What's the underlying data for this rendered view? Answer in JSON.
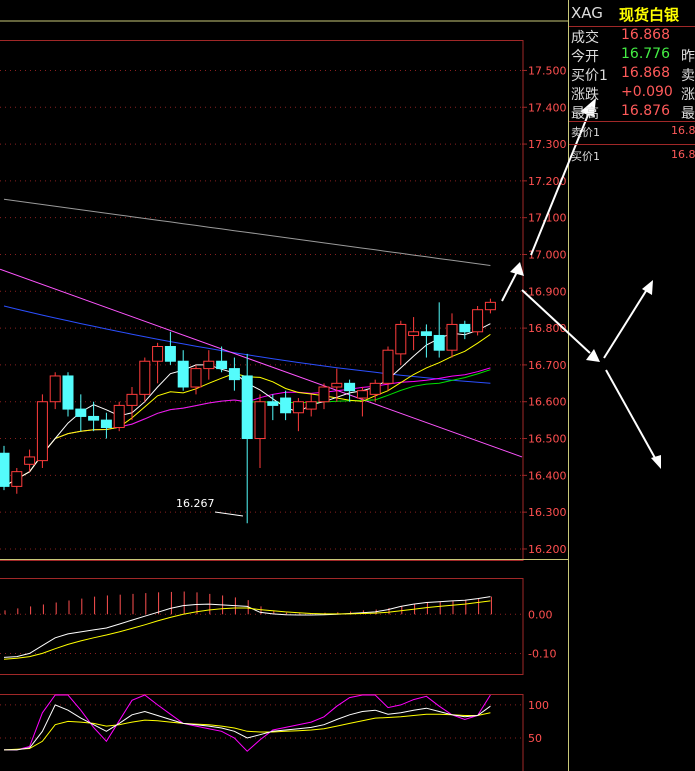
{
  "chart_data": [
    {
      "type": "candlestick",
      "title": "",
      "y_ticks": [
        "17.500",
        "17.400",
        "17.300",
        "17.200",
        "17.100",
        "17.000",
        "16.900",
        "16.800",
        "16.700",
        "16.600",
        "16.500",
        "16.400",
        "16.300",
        "16.200"
      ],
      "ylim": [
        16.17,
        17.58
      ],
      "low_annotation": "16.267",
      "candles": [
        {
          "o": 16.46,
          "h": 16.48,
          "l": 16.36,
          "c": 16.37
        },
        {
          "o": 16.37,
          "h": 16.42,
          "l": 16.35,
          "c": 16.41
        },
        {
          "o": 16.43,
          "h": 16.47,
          "l": 16.41,
          "c": 16.45
        },
        {
          "o": 16.44,
          "h": 16.62,
          "l": 16.42,
          "c": 16.6
        },
        {
          "o": 16.6,
          "h": 16.68,
          "l": 16.58,
          "c": 16.67
        },
        {
          "o": 16.67,
          "h": 16.68,
          "l": 16.56,
          "c": 16.58
        },
        {
          "o": 16.58,
          "h": 16.62,
          "l": 16.52,
          "c": 16.56
        },
        {
          "o": 16.56,
          "h": 16.6,
          "l": 16.52,
          "c": 16.55
        },
        {
          "o": 16.55,
          "h": 16.57,
          "l": 16.5,
          "c": 16.53
        },
        {
          "o": 16.53,
          "h": 16.6,
          "l": 16.52,
          "c": 16.59
        },
        {
          "o": 16.59,
          "h": 16.64,
          "l": 16.55,
          "c": 16.62
        },
        {
          "o": 16.62,
          "h": 16.72,
          "l": 16.6,
          "c": 16.71
        },
        {
          "o": 16.71,
          "h": 16.76,
          "l": 16.65,
          "c": 16.75
        },
        {
          "o": 16.75,
          "h": 16.79,
          "l": 16.7,
          "c": 16.71
        },
        {
          "o": 16.71,
          "h": 16.74,
          "l": 16.63,
          "c": 16.64
        },
        {
          "o": 16.64,
          "h": 16.7,
          "l": 16.62,
          "c": 16.69
        },
        {
          "o": 16.69,
          "h": 16.74,
          "l": 16.66,
          "c": 16.71
        },
        {
          "o": 16.71,
          "h": 16.75,
          "l": 16.68,
          "c": 16.69
        },
        {
          "o": 16.69,
          "h": 16.72,
          "l": 16.63,
          "c": 16.66
        },
        {
          "o": 16.67,
          "h": 16.73,
          "l": 16.27,
          "c": 16.5
        },
        {
          "o": 16.5,
          "h": 16.62,
          "l": 16.42,
          "c": 16.6
        },
        {
          "o": 16.6,
          "h": 16.62,
          "l": 16.55,
          "c": 16.59
        },
        {
          "o": 16.61,
          "h": 16.63,
          "l": 16.55,
          "c": 16.57
        },
        {
          "o": 16.57,
          "h": 16.61,
          "l": 16.52,
          "c": 16.6
        },
        {
          "o": 16.58,
          "h": 16.62,
          "l": 16.56,
          "c": 16.6
        },
        {
          "o": 16.6,
          "h": 16.65,
          "l": 16.58,
          "c": 16.64
        },
        {
          "o": 16.64,
          "h": 16.69,
          "l": 16.6,
          "c": 16.65
        },
        {
          "o": 16.65,
          "h": 16.66,
          "l": 16.6,
          "c": 16.63
        },
        {
          "o": 16.61,
          "h": 16.64,
          "l": 16.56,
          "c": 16.63
        },
        {
          "o": 16.62,
          "h": 16.66,
          "l": 16.6,
          "c": 16.65
        },
        {
          "o": 16.65,
          "h": 16.75,
          "l": 16.63,
          "c": 16.74
        },
        {
          "o": 16.73,
          "h": 16.82,
          "l": 16.7,
          "c": 16.81
        },
        {
          "o": 16.78,
          "h": 16.83,
          "l": 16.74,
          "c": 16.79
        },
        {
          "o": 16.79,
          "h": 16.81,
          "l": 16.72,
          "c": 16.78
        },
        {
          "o": 16.78,
          "h": 16.87,
          "l": 16.72,
          "c": 16.74
        },
        {
          "o": 16.74,
          "h": 16.84,
          "l": 16.72,
          "c": 16.81
        },
        {
          "o": 16.81,
          "h": 16.82,
          "l": 16.77,
          "c": 16.79
        },
        {
          "o": 16.79,
          "h": 16.86,
          "l": 16.78,
          "c": 16.85
        },
        {
          "o": 16.85,
          "h": 16.88,
          "l": 16.84,
          "c": 16.87
        }
      ],
      "colors": {
        "up": "#ff3c3c",
        "down": "#54fcfc",
        "ma5": "#ffffff",
        "ma10": "#ffff00",
        "ma20": "#ff00ff",
        "ma30": "#00e000",
        "ma60": "#2b4fff",
        "ma120": "#9a9a9a",
        "trend": "#ff55ff"
      }
    },
    {
      "type": "bar",
      "title": "",
      "y_ticks": [
        "0.00",
        "-0.10"
      ],
      "ylim": [
        -0.155,
        0.09
      ],
      "bars": [
        0.01,
        0.015,
        0.02,
        0.025,
        0.03,
        0.035,
        0.04,
        0.045,
        0.048,
        0.05,
        0.052,
        0.054,
        0.056,
        0.057,
        0.058,
        0.056,
        0.052,
        0.048,
        0.043,
        0.036,
        0.02,
        0.008,
        0.004,
        0.002,
        0.003,
        0.004,
        0.005,
        0.007,
        0.01,
        0.012,
        0.016,
        0.02,
        0.025,
        0.03,
        0.032,
        0.034,
        0.036,
        0.04,
        0.045
      ],
      "dif": [
        -0.11,
        -0.108,
        -0.1,
        -0.08,
        -0.06,
        -0.05,
        -0.045,
        -0.04,
        -0.035,
        -0.025,
        -0.015,
        -0.005,
        0.005,
        0.015,
        0.022,
        0.025,
        0.026,
        0.024,
        0.022,
        0.02,
        0.005,
        0.001,
        -0.001,
        -0.002,
        -0.002,
        -0.001,
        0.0,
        0.002,
        0.004,
        0.006,
        0.012,
        0.02,
        0.026,
        0.03,
        0.032,
        0.034,
        0.036,
        0.04,
        0.045
      ],
      "dea": [
        -0.115,
        -0.112,
        -0.108,
        -0.1,
        -0.088,
        -0.077,
        -0.068,
        -0.06,
        -0.053,
        -0.045,
        -0.036,
        -0.027,
        -0.017,
        -0.008,
        0.0,
        0.006,
        0.011,
        0.014,
        0.016,
        0.016,
        0.012,
        0.009,
        0.006,
        0.004,
        0.002,
        0.001,
        0.001,
        0.001,
        0.002,
        0.003,
        0.005,
        0.009,
        0.013,
        0.017,
        0.02,
        0.023,
        0.026,
        0.03,
        0.034
      ]
    },
    {
      "type": "line",
      "title": "",
      "y_ticks": [
        "100",
        "50"
      ],
      "ylim": [
        0,
        115
      ],
      "k": [
        32,
        32,
        35,
        60,
        100,
        92,
        80,
        70,
        60,
        72,
        85,
        90,
        84,
        78,
        72,
        70,
        68,
        65,
        60,
        50,
        55,
        60,
        62,
        64,
        66,
        70,
        78,
        85,
        90,
        92,
        86,
        88,
        92,
        95,
        90,
        85,
        82,
        84,
        98
      ],
      "d": [
        32,
        33,
        34,
        45,
        70,
        75,
        74,
        72,
        68,
        70,
        74,
        77,
        76,
        74,
        72,
        71,
        70,
        68,
        65,
        60,
        59,
        59,
        60,
        61,
        62,
        64,
        68,
        72,
        76,
        80,
        81,
        82,
        84,
        86,
        86,
        85,
        84,
        84,
        88
      ],
      "j": [
        32,
        32,
        37,
        88,
        150,
        125,
        92,
        66,
        45,
        76,
        107,
        116,
        100,
        86,
        72,
        68,
        64,
        60,
        50,
        30,
        47,
        62,
        66,
        70,
        74,
        82,
        98,
        111,
        118,
        116,
        96,
        100,
        108,
        113,
        98,
        85,
        78,
        84,
        118
      ]
    }
  ],
  "quote": {
    "code": "XAG",
    "name": "现货白银",
    "rows": [
      {
        "label": "成交",
        "value": "16.868",
        "color": "#ff5a5a",
        "tail": ""
      },
      {
        "label": "今开",
        "value": "16.776",
        "color": "#44ee44",
        "tail": "昨"
      },
      {
        "label": "买价1",
        "value": "16.868",
        "color": "#ff5a5a",
        "tail": "卖"
      },
      {
        "label": "涨跌",
        "value": "+0.090",
        "color": "#ff5a5a",
        "tail": "涨"
      },
      {
        "label": "最高",
        "value": "16.876",
        "color": "#ff5a5a",
        "tail": "最"
      }
    ],
    "book": [
      {
        "label": "卖价1",
        "price": "16.8"
      },
      {
        "label": "买价1",
        "price": "16.8"
      }
    ]
  }
}
